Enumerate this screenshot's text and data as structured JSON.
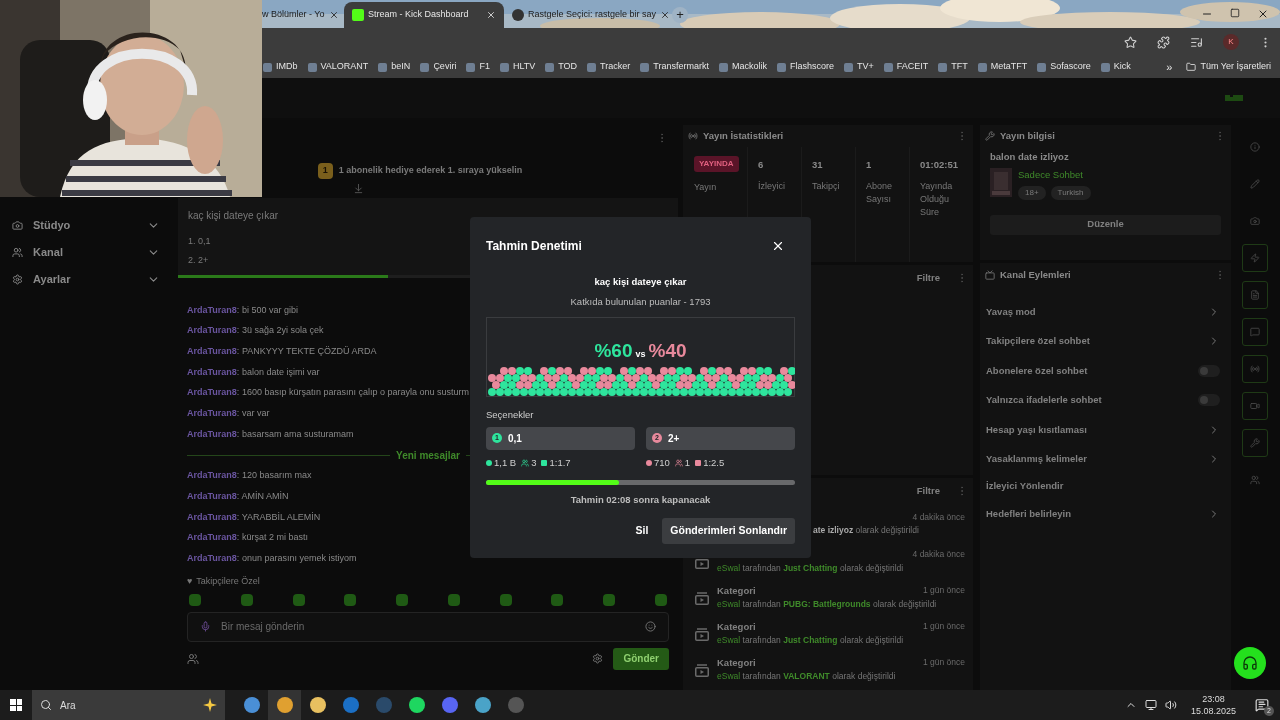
{
  "browser": {
    "tabs": [
      {
        "title": "w Bölümler - Yo",
        "selected": false
      },
      {
        "title": "Stream - Kick Dashboard",
        "selected": true
      },
      {
        "title": "Rastgele Seçici: rastgele bir say",
        "selected": false
      }
    ],
    "new_tab": "+",
    "profile": "K",
    "bookmarks": [
      "IMDb",
      "VALORANT",
      "beIN",
      "Çeviri",
      "F1",
      "HLTV",
      "TOD",
      "Tracker",
      "Transfermarkt",
      "Mackolik",
      "Flashscore",
      "TV+",
      "FACEIT",
      "TFT",
      "MetaTFT",
      "Sofascore",
      "Kick"
    ],
    "bookmarks_more": "»",
    "all_bookmarks": "Tüm Yer İşaretleri"
  },
  "sidebar": {
    "items": [
      "Stüdyo",
      "Kanal",
      "Ayarlar"
    ]
  },
  "chat": {
    "gift_banner": {
      "rank": "1",
      "text": "1 abonelik hediye ederek 1. sıraya yükselin"
    },
    "pinned_poll": {
      "question": "kaç kişi dateye çıkar",
      "options": [
        "1. 0,1",
        "2. 2+"
      ],
      "level": 0.42
    },
    "messages": [
      {
        "kind": "message",
        "user": "ArdaTuran8",
        "text": "bi 500 var gibi"
      },
      {
        "kind": "message",
        "user": "ArdaTuran8",
        "text": "3ü sağa 2yi sola çek"
      },
      {
        "kind": "message",
        "user": "ArdaTuran8",
        "text": "PANKYYY TEKTE ÇÖZDÜ ARDA"
      },
      {
        "kind": "message",
        "user": "ArdaTuran8",
        "text": "balon date işimi var"
      },
      {
        "kind": "message",
        "user": "ArdaTuran8",
        "text": "1600 basıp kürşatın parasını çalıp o parayla onu susturm"
      },
      {
        "kind": "message",
        "user": "ArdaTuran8",
        "text": "var var"
      },
      {
        "kind": "message",
        "user": "ArdaTuran8",
        "text": "basarsam ama susturamam"
      },
      {
        "kind": "divider",
        "text": "Yeni mesajlar"
      },
      {
        "kind": "message",
        "user": "ArdaTuran8",
        "text": "120 basarım max"
      },
      {
        "kind": "message",
        "user": "ArdaTuran8",
        "text": "AMİN AMİN"
      },
      {
        "kind": "message",
        "user": "ArdaTuran8",
        "text": "YARABBİL ALEMİN"
      },
      {
        "kind": "message",
        "user": "ArdaTuran8",
        "text": "kürşat 2 mi bastı"
      },
      {
        "kind": "message",
        "user": "ArdaTuran8",
        "text": "onun parasını yemek istiyom"
      }
    ],
    "separator": ":",
    "emote_section_icon": "♥",
    "emote_section": "Takipçilere Özel",
    "input": {
      "placeholder": "Bir mesaj gönderin"
    },
    "send_button": "Gönder"
  },
  "stats": {
    "title": "Yayın İstatistikleri",
    "live_badge": "YAYINDA",
    "live_label": "Yayın",
    "items": [
      {
        "value": "6",
        "label": "İzleyici"
      },
      {
        "value": "31",
        "label": "Takipçi"
      },
      {
        "value": "1",
        "label": "Abone Sayısı"
      },
      {
        "value": "01:02:51",
        "label": "Yayında Olduğu Süre"
      }
    ]
  },
  "chat_panel": {
    "filter": "Filtre"
  },
  "activity": {
    "filter": "Filtre",
    "items": [
      {
        "kind": "partial",
        "text": "**ate izliyoz** olarak değiştirildi",
        "time": "4 dakika önce"
      },
      {
        "kind": "category",
        "user": "eSwal",
        "middle": "tarafından",
        "value": "Just Chatting",
        "suffix": "olarak değiştirildi",
        "time": "4 dakika önce"
      },
      {
        "kind": "category",
        "title": "Kategori",
        "user": "eSwal",
        "middle": "tarafından",
        "value": "PUBG: Battlegrounds",
        "suffix": "olarak değiştirildi",
        "time": "1 gün önce"
      },
      {
        "kind": "category",
        "title": "Kategori",
        "user": "eSwal",
        "middle": "tarafından",
        "value": "Just Chatting",
        "suffix": "olarak değiştirildi",
        "time": "1 gün önce"
      },
      {
        "kind": "category",
        "title": "Kategori",
        "user": "eSwal",
        "middle": "tarafından",
        "value": "VALORANT",
        "suffix": "olarak değiştirildi",
        "time": "1 gün önce"
      }
    ]
  },
  "stream_info": {
    "title": "Yayın bilgisi",
    "stream_title": "balon date izliyoz",
    "category": "Sadece Sohbet",
    "tags": [
      "18+",
      "Turkish"
    ],
    "edit_button": "Düzenle"
  },
  "channel_actions": {
    "title": "Kanal Eylemleri",
    "items": [
      {
        "kind": "link",
        "label": "Yavaş mod"
      },
      {
        "kind": "link",
        "label": "Takipçilere özel sohbet"
      },
      {
        "kind": "toggle",
        "label": "Abonelere özel sohbet",
        "on": false
      },
      {
        "kind": "toggle",
        "label": "Yalnızca ifadelerle sohbet",
        "on": false
      },
      {
        "kind": "link",
        "label": "Hesap yaşı kısıtlaması"
      },
      {
        "kind": "link",
        "label": "Yasaklanmış kelimeler"
      },
      {
        "kind": "plain",
        "label": "İzleyici Yönlendir"
      },
      {
        "kind": "link",
        "label": "Hedefleri belirleyin"
      }
    ]
  },
  "modal": {
    "title": "Tahmin Denetimi",
    "question": "kaç kişi dateye çıkar",
    "points": "Katkıda bulunulan puanlar - 1793",
    "split": {
      "left": "%60",
      "vs": "vs",
      "right": "%40"
    },
    "options_label": "Seçenekler",
    "options": [
      {
        "number": "1",
        "label": "0,1",
        "color": "#2ee59d",
        "points": "1,1 B",
        "users": "3",
        "ratio": "1:1.7"
      },
      {
        "number": "2",
        "label": "2+",
        "color": "#e8899c",
        "points": "710",
        "users": "1",
        "ratio": "1:2.5"
      }
    ],
    "level": 0.43,
    "timer": "Tahmin 02:08 sonra kapanacak",
    "delete_button": "Sil",
    "end_button": "Gönderimleri Sonlandır"
  },
  "taskbar": {
    "search_placeholder": "Ara",
    "time": "23:08",
    "date": "15.08.2025",
    "notifications": "2"
  }
}
